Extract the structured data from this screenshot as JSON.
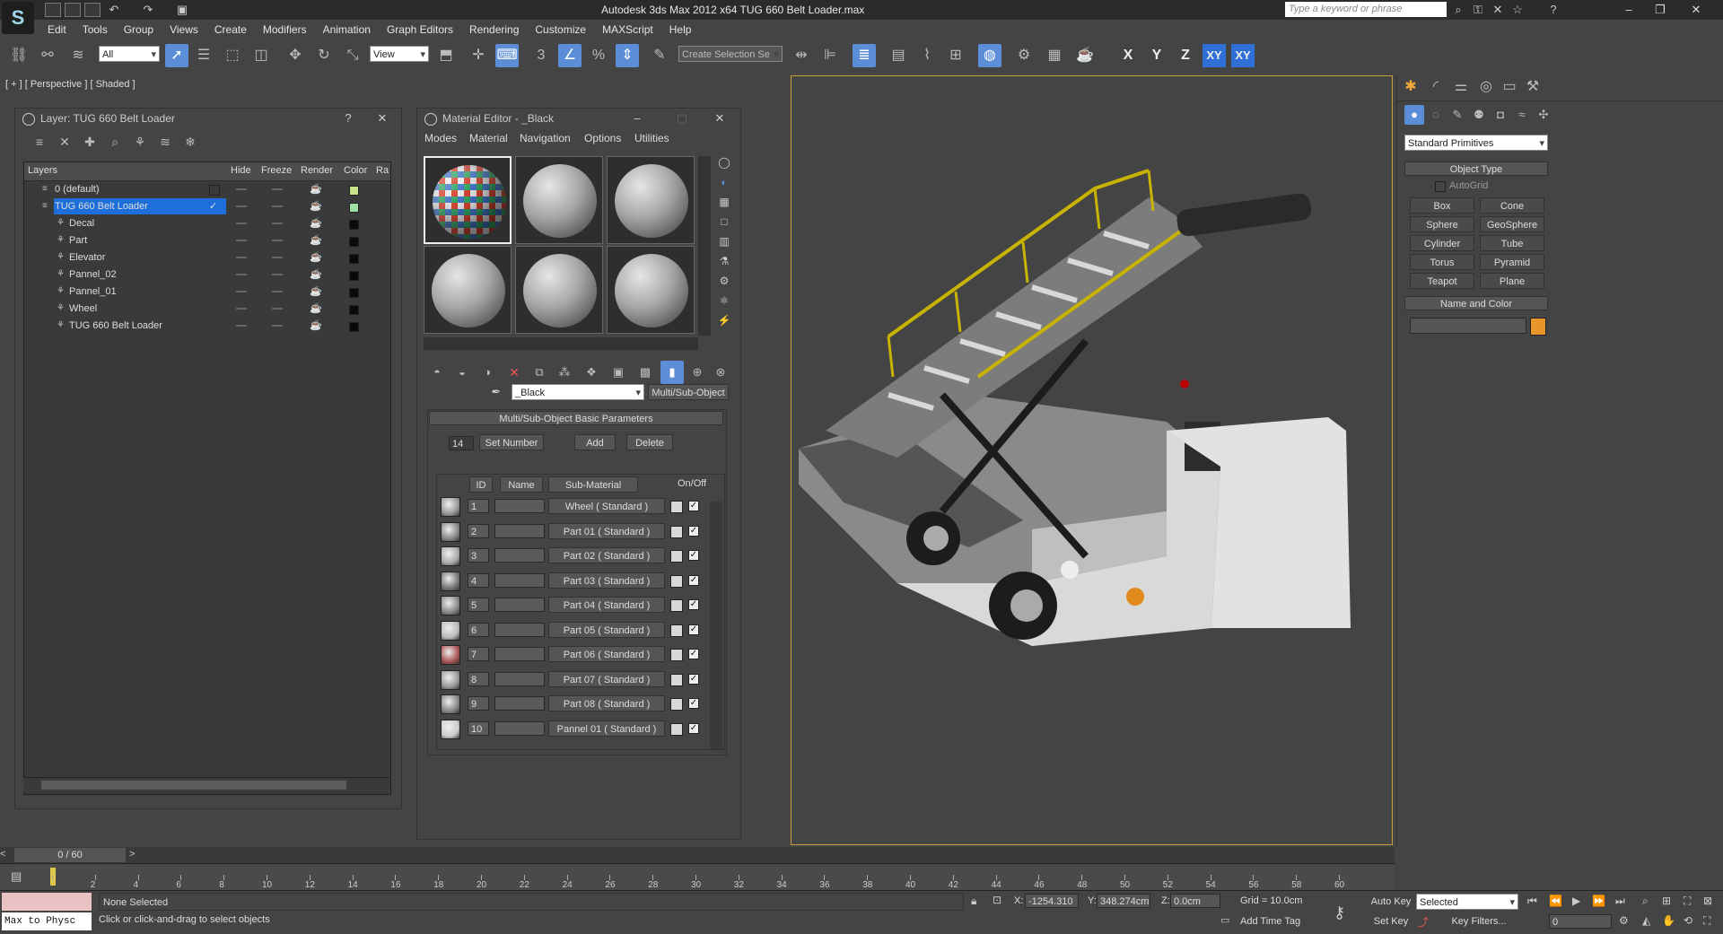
{
  "app": {
    "title": "Autodesk 3ds Max  2012 x64     TUG 660 Belt Loader.max",
    "logo": "S",
    "search_placeholder": "Type a keyword or phrase"
  },
  "menu": [
    "Edit",
    "Tools",
    "Group",
    "Views",
    "Create",
    "Modifiers",
    "Animation",
    "Graph Editors",
    "Rendering",
    "Customize",
    "MAXScript",
    "Help"
  ],
  "toolbar": {
    "filter": "All",
    "ref_coord": "View",
    "selection_set": "Create Selection Se",
    "axis": [
      "X",
      "Y",
      "Z",
      "XY",
      "XY"
    ],
    "snap_num": "3"
  },
  "viewport": {
    "label": "[ + ] [ Perspective ] [ Shaded ]"
  },
  "layer_window": {
    "title": "Layer: TUG 660 Belt Loader",
    "cols": [
      "Layers",
      "Hide",
      "Freeze",
      "Render",
      "Color",
      "Ra"
    ],
    "rows": [
      {
        "name": "0 (default)",
        "color": "#c8e28c",
        "depth": 0
      },
      {
        "name": "TUG 660 Belt Loader",
        "color": "#9fe0a4",
        "depth": 0,
        "selected": true
      },
      {
        "name": "Decal",
        "color": "#0a0a0a",
        "depth": 1
      },
      {
        "name": "Part",
        "color": "#0a0a0a",
        "depth": 1
      },
      {
        "name": "Elevator",
        "color": "#0a0a0a",
        "depth": 1
      },
      {
        "name": "Pannel_02",
        "color": "#0a0a0a",
        "depth": 1
      },
      {
        "name": "Pannel_01",
        "color": "#0a0a0a",
        "depth": 1
      },
      {
        "name": "Wheel",
        "color": "#0a0a0a",
        "depth": 1
      },
      {
        "name": "TUG 660 Belt Loader",
        "color": "#0a0a0a",
        "depth": 1
      }
    ]
  },
  "material_editor": {
    "title": "Material Editor - _Black",
    "menu": [
      "Modes",
      "Material",
      "Navigation",
      "Options",
      "Utilities"
    ],
    "material_name": "_Black",
    "material_type": "Multi/Sub-Object",
    "rollout": "Multi/Sub-Object Basic Parameters",
    "count": "14",
    "set_number": "Set Number",
    "add": "Add",
    "delete": "Delete",
    "cols": [
      "ID",
      "Name",
      "Sub-Material",
      "On/Off"
    ],
    "rows": [
      {
        "id": "1",
        "sub": "Wheel  ( Standard )"
      },
      {
        "id": "2",
        "sub": "Part 01  ( Standard )"
      },
      {
        "id": "3",
        "sub": "Part 02  ( Standard )"
      },
      {
        "id": "4",
        "sub": "Part 03  ( Standard )"
      },
      {
        "id": "5",
        "sub": "Part 04  ( Standard )"
      },
      {
        "id": "6",
        "sub": "Part 05  ( Standard )"
      },
      {
        "id": "7",
        "sub": "Part 06  ( Standard )"
      },
      {
        "id": "8",
        "sub": "Part 07  ( Standard )"
      },
      {
        "id": "9",
        "sub": "Part 08  ( Standard )"
      },
      {
        "id": "10",
        "sub": "Pannel 01  ( Standard )"
      }
    ]
  },
  "command_panel": {
    "category": "Standard Primitives",
    "object_type": "Object Type",
    "autogrid": "AutoGrid",
    "buttons": [
      "Box",
      "Cone",
      "Sphere",
      "GeoSphere",
      "Cylinder",
      "Tube",
      "Torus",
      "Pyramid",
      "Teapot",
      "Plane"
    ],
    "name_and_color": "Name and Color",
    "color": "#e8962c"
  },
  "timeline": {
    "frame": "0 / 60",
    "ticks": [
      "0",
      "2",
      "4",
      "6",
      "8",
      "10",
      "12",
      "14",
      "16",
      "18",
      "20",
      "22",
      "24",
      "26",
      "28",
      "30",
      "32",
      "34",
      "36",
      "38",
      "40",
      "42",
      "44",
      "46",
      "48",
      "50",
      "52",
      "54",
      "56",
      "58",
      "60"
    ]
  },
  "status": {
    "listener": "Max to Physc",
    "selected": "None Selected",
    "prompt": "Click or click-and-drag to select objects",
    "x": "-1254.310",
    "y": "348.274cm",
    "z": "0.0cm",
    "grid": "Grid = 10.0cm",
    "add_time_tag": "Add Time Tag",
    "auto_key": "Auto Key",
    "set_key": "Set Key",
    "key_mode": "Selected",
    "key_filters": "Key Filters...",
    "frame_field": "0"
  }
}
